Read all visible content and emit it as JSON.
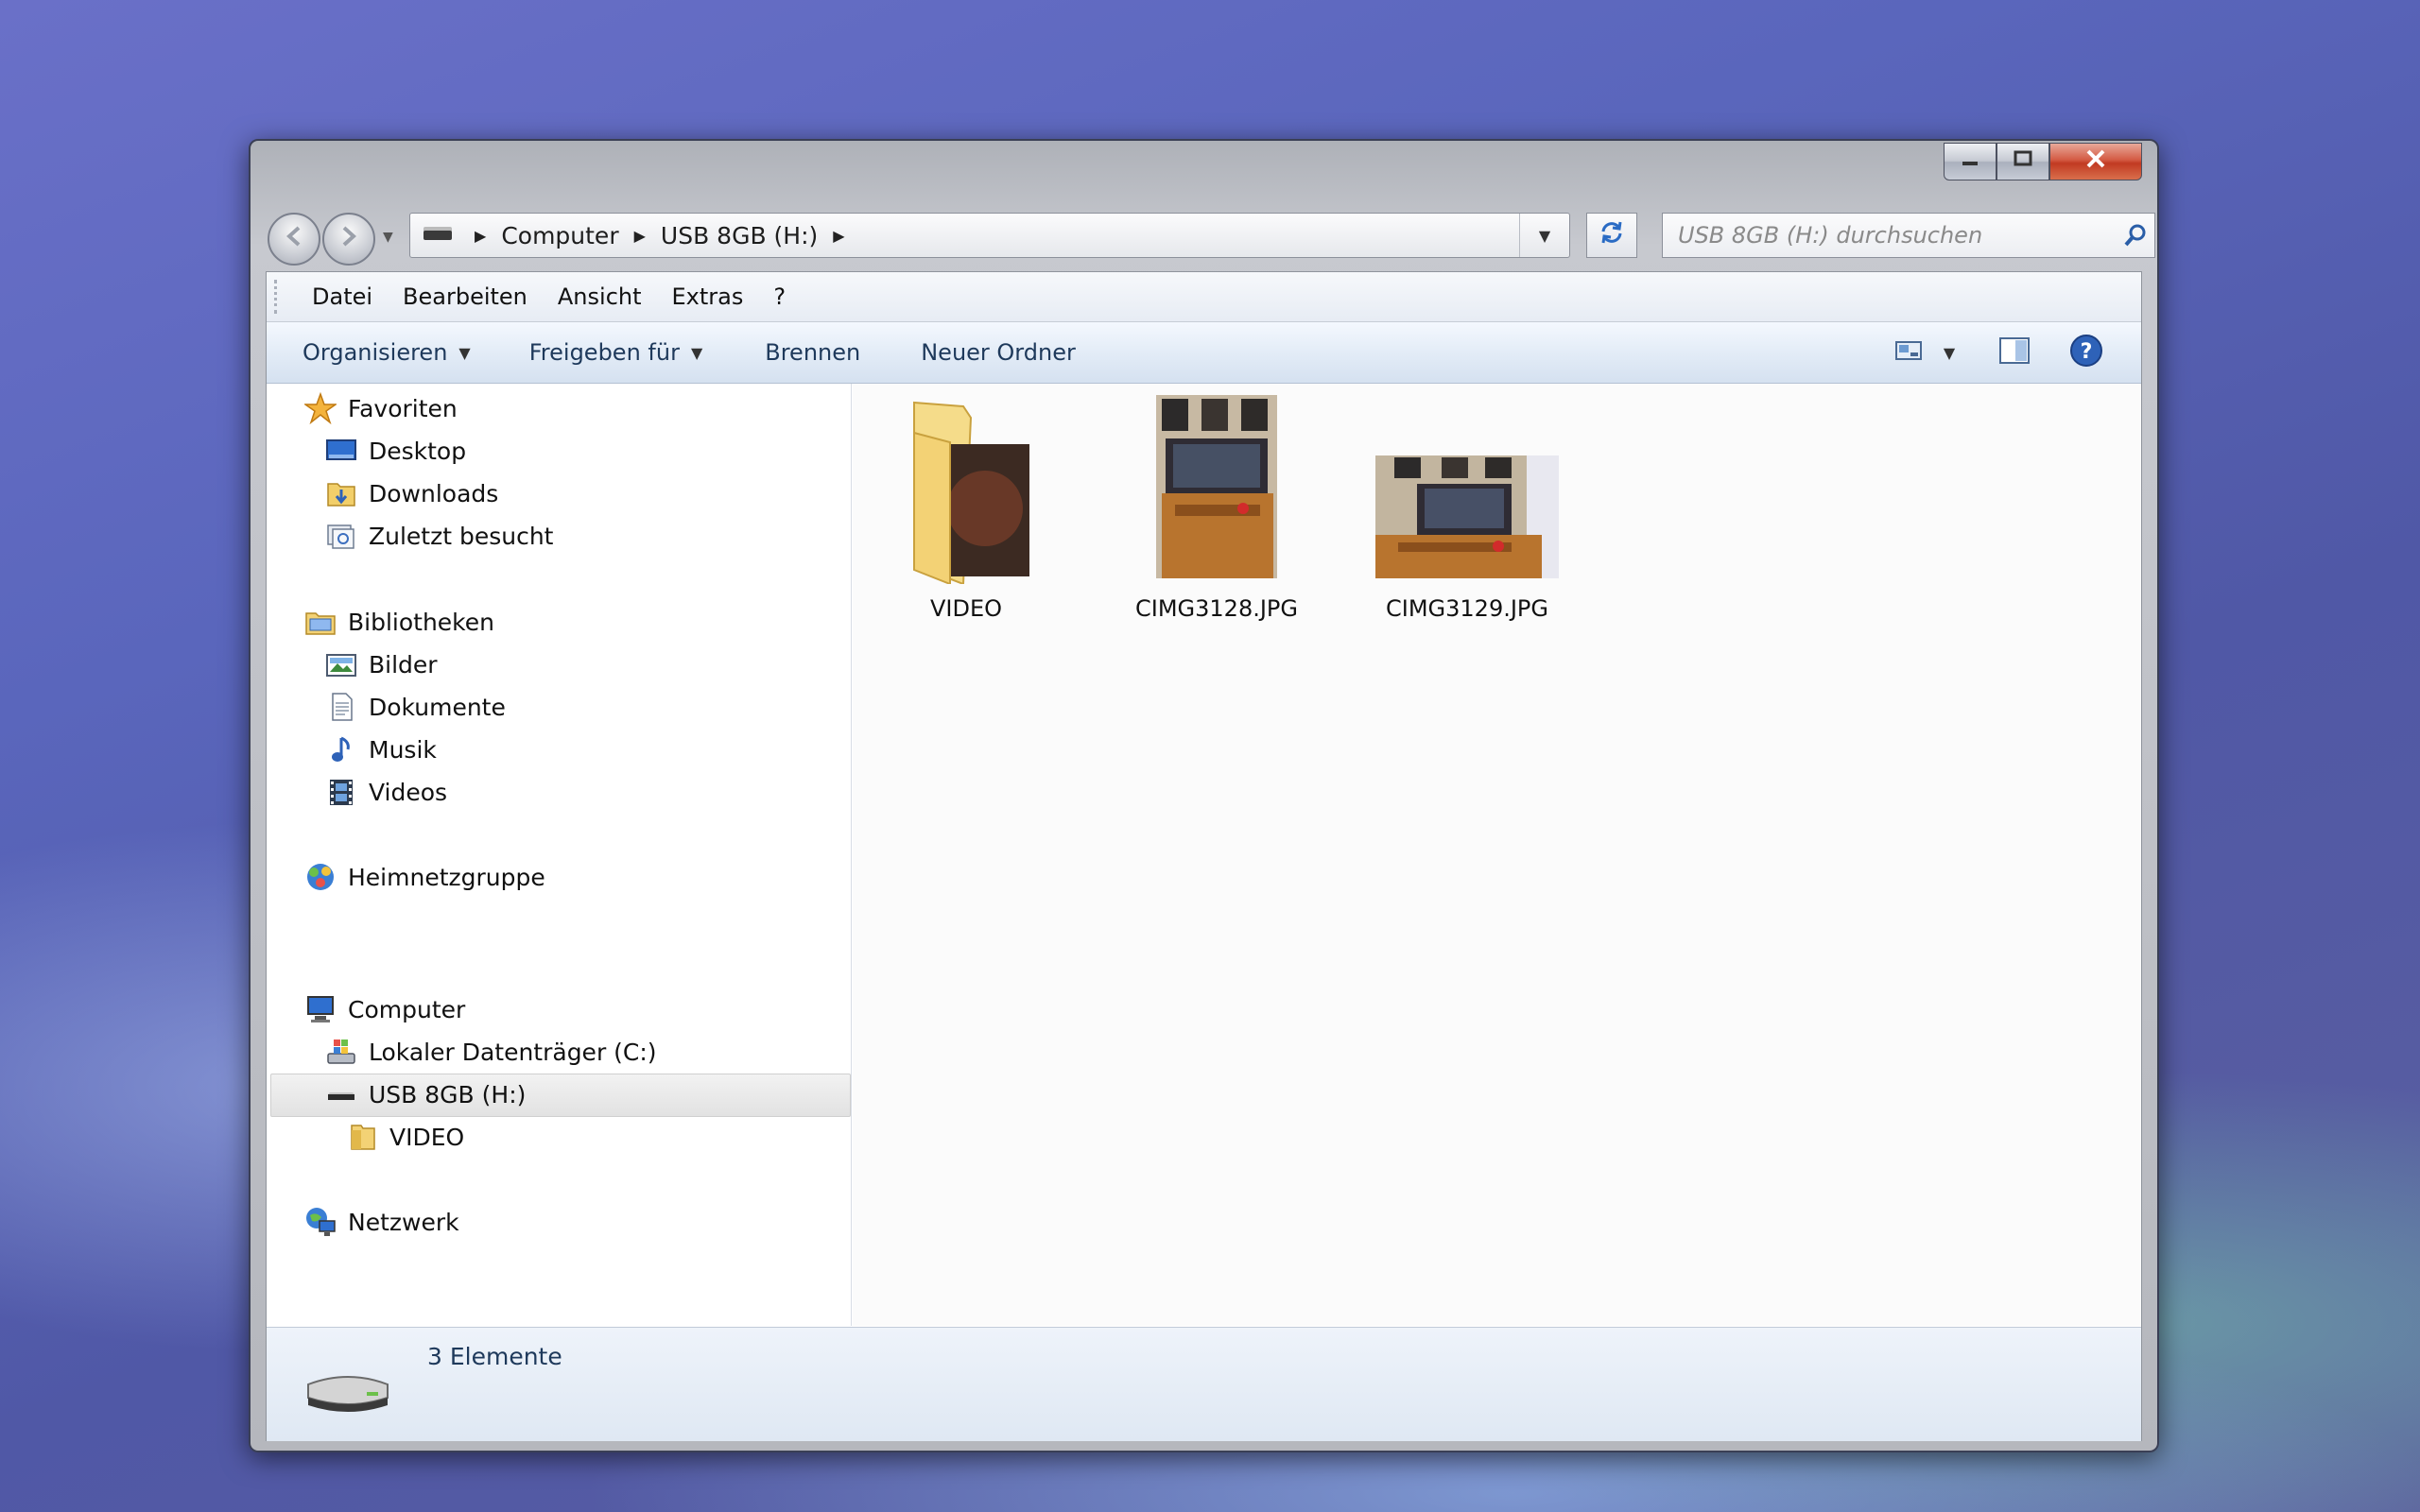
{
  "window": {
    "controls": {
      "minimize": "minimize-icon",
      "maximize": "maximize-icon",
      "close": "close-icon"
    }
  },
  "navigation": {
    "back_icon": "back-arrow-icon",
    "forward_icon": "forward-arrow-icon",
    "breadcrumb": [
      "Computer",
      "USB 8GB (H:)"
    ],
    "search_placeholder": "USB 8GB (H:) durchsuchen"
  },
  "menubar": {
    "items": [
      "Datei",
      "Bearbeiten",
      "Ansicht",
      "Extras",
      "?"
    ]
  },
  "toolbar": {
    "organize": "Organisieren",
    "share": "Freigeben für",
    "burn": "Brennen",
    "new_folder": "Neuer Ordner"
  },
  "sidebar": {
    "favorites": {
      "label": "Favoriten",
      "items": [
        "Desktop",
        "Downloads",
        "Zuletzt besucht"
      ]
    },
    "libraries": {
      "label": "Bibliotheken",
      "items": [
        "Bilder",
        "Dokumente",
        "Musik",
        "Videos"
      ]
    },
    "homegroup": {
      "label": "Heimnetzgruppe"
    },
    "computer": {
      "label": "Computer",
      "items": [
        "Lokaler Datenträger (C:)",
        "USB 8GB (H:)"
      ],
      "subitems": [
        "VIDEO"
      ],
      "selected": "USB 8GB (H:)"
    },
    "network": {
      "label": "Netzwerk"
    }
  },
  "files": [
    {
      "name": "VIDEO",
      "type": "folder"
    },
    {
      "name": "CIMG3128.JPG",
      "type": "image"
    },
    {
      "name": "CIMG3129.JPG",
      "type": "image"
    }
  ],
  "status": {
    "text": "3 Elemente"
  },
  "colors": {
    "accent": "#2a6bc4",
    "toolbar_text": "#1e395b",
    "close_red": "#c13a22"
  }
}
